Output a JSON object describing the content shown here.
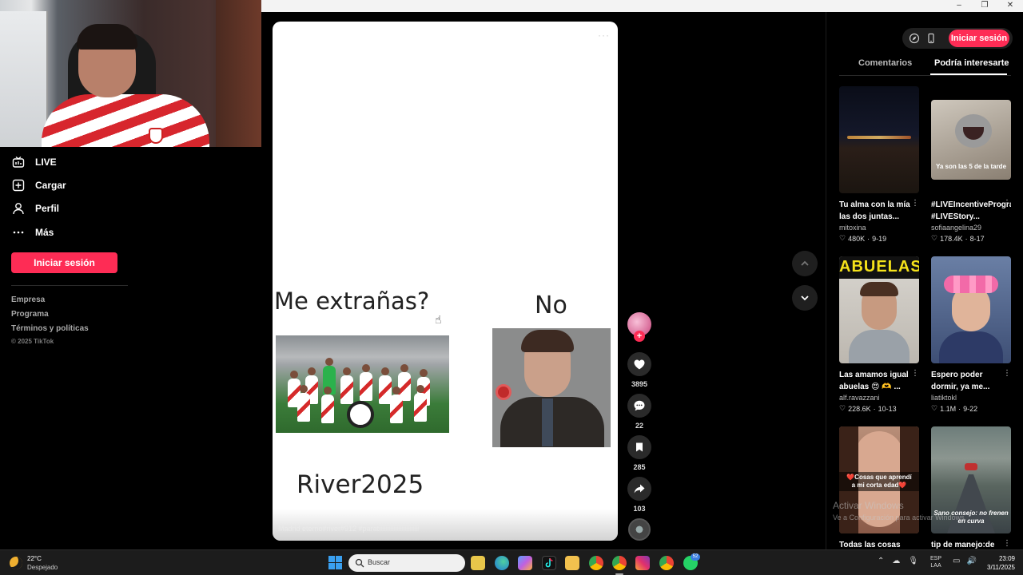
{
  "window": {
    "minimize": "–",
    "restore": "❐",
    "close": "✕"
  },
  "leftnav": {
    "items": [
      {
        "label": "LIVE",
        "icon": "live-icon"
      },
      {
        "label": "Cargar",
        "icon": "upload-icon"
      },
      {
        "label": "Perfil",
        "icon": "profile-icon"
      },
      {
        "label": "Más",
        "icon": "more-icon"
      }
    ],
    "login_label": "Iniciar sesión",
    "footer_links": [
      "Empresa",
      "Programa",
      "Términos y políticas"
    ],
    "copyright": "© 2025 TikTok"
  },
  "video": {
    "more": "···",
    "meme_question": "Me extrañas?",
    "meme_answer": "No",
    "meme_footer": "River2025",
    "caption": "Madrid eterno#river#912 #paratiiiiiiiiiiiiiiiiiiiiiiiii"
  },
  "actions": {
    "likes": "3895",
    "comments": "22",
    "saves": "285",
    "shares": "103"
  },
  "rightpanel": {
    "login_label": "Iniciar sesión",
    "tabs": [
      "Comentarios",
      "Podría interesarte"
    ],
    "active_tab": "Podría interesarte",
    "cards": [
      {
        "title": "Tu alma con la mía las dos juntas...",
        "author": "mitoxina",
        "likes": "480K",
        "date": "9-19",
        "overlay": ""
      },
      {
        "title": "#LIVEIncentiveProgram #LIVEStory...",
        "author": "sofiaangelina29",
        "likes": "178.4K",
        "date": "8-17",
        "overlay": "Ya son las 5 de la tarde"
      },
      {
        "title": "Las amamos igual abuelas 😍 🫶 ...",
        "author": "alf.ravazzani",
        "likes": "228.6K",
        "date": "10-13",
        "overlay": "ABUELAS"
      },
      {
        "title": "Espero poder dormir, ya me...",
        "author": "liatiktokl",
        "likes": "1.1M",
        "date": "9-22",
        "overlay": ""
      },
      {
        "title": "Todas las cosas",
        "author": "",
        "likes": "",
        "date": "",
        "overlay": "❤️Cosas que aprendí a mi corta edad❤️"
      },
      {
        "title": "tip de manejo:de",
        "author": "",
        "likes": "",
        "date": "",
        "overlay": "Sano consejo: no frenen en curva"
      }
    ]
  },
  "watermark": {
    "title": "Activar Windows",
    "subtitle": "Ve a Configuración para activar Windows."
  },
  "taskbar": {
    "temp": "22°C",
    "weather": "Despejado",
    "search_placeholder": "Buscar",
    "lang_top": "ESP",
    "lang_bottom": "LAA",
    "time": "23:09",
    "date": "3/11/2025",
    "badge": "52"
  }
}
